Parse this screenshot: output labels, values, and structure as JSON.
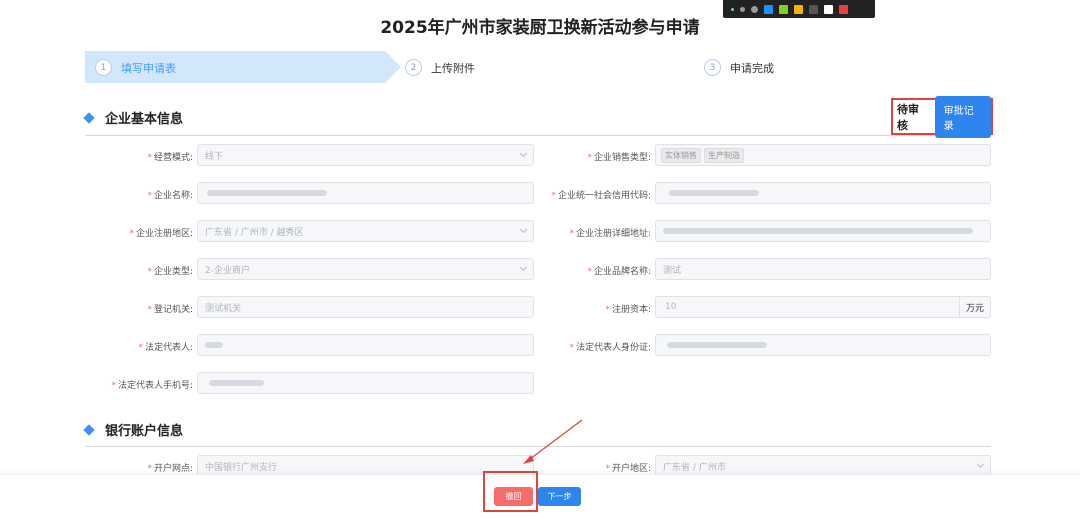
{
  "page": {
    "title": "2025年广州市家装厨卫换新活动参与申请"
  },
  "toolbar": {
    "colors": [
      "#1e90ff",
      "#7ed321",
      "#f5b400",
      "#555555",
      "#ffffff",
      "#e94040"
    ]
  },
  "steps": [
    {
      "num": "1",
      "label": "填写申请表",
      "active": true
    },
    {
      "num": "2",
      "label": "上传附件",
      "active": false
    },
    {
      "num": "3",
      "label": "申请完成",
      "active": false
    }
  ],
  "section_basic": {
    "title": "企业基本信息"
  },
  "status": {
    "text": "待审核",
    "audit_button": "审批记录"
  },
  "fields": {
    "business_mode": {
      "label": "经营模式:",
      "value": "线下"
    },
    "sales_type": {
      "label": "企业销售类型:",
      "tags": [
        "实体销售",
        "生产制造"
      ]
    },
    "company_name": {
      "label": "企业名称:"
    },
    "credit_code": {
      "label": "企业统一社会信用代码:"
    },
    "reg_region": {
      "label": "企业注册地区:",
      "value": "广东省 / 广州市 / 越秀区"
    },
    "reg_address": {
      "label": "企业注册详细地址:"
    },
    "company_type": {
      "label": "企业类型:",
      "value": "2-企业商户"
    },
    "brand_name": {
      "label": "企业品牌名称:",
      "value": "测试"
    },
    "reg_authority": {
      "label": "登记机关:",
      "value": "测试机关"
    },
    "reg_capital": {
      "label": "注册资本:",
      "value": "10",
      "unit": "万元"
    },
    "legal_rep": {
      "label": "法定代表人:"
    },
    "legal_rep_id": {
      "label": "法定代表人身份证:"
    },
    "legal_rep_phone": {
      "label": "法定代表人手机号:"
    }
  },
  "section_bank": {
    "title": "银行账户信息"
  },
  "bank_fields": {
    "branch": {
      "label": "开户网点:",
      "value": "中国银行广州支行"
    },
    "region": {
      "label": "开户地区:",
      "value": "广东省 / 广州市"
    }
  },
  "footer": {
    "withdraw": "撤回",
    "next": "下一步"
  },
  "colors": {
    "accent": "#2f85ee",
    "danger": "#f56c6c",
    "highlight": "#e0433c",
    "step_bg": "#d3e7fb"
  }
}
